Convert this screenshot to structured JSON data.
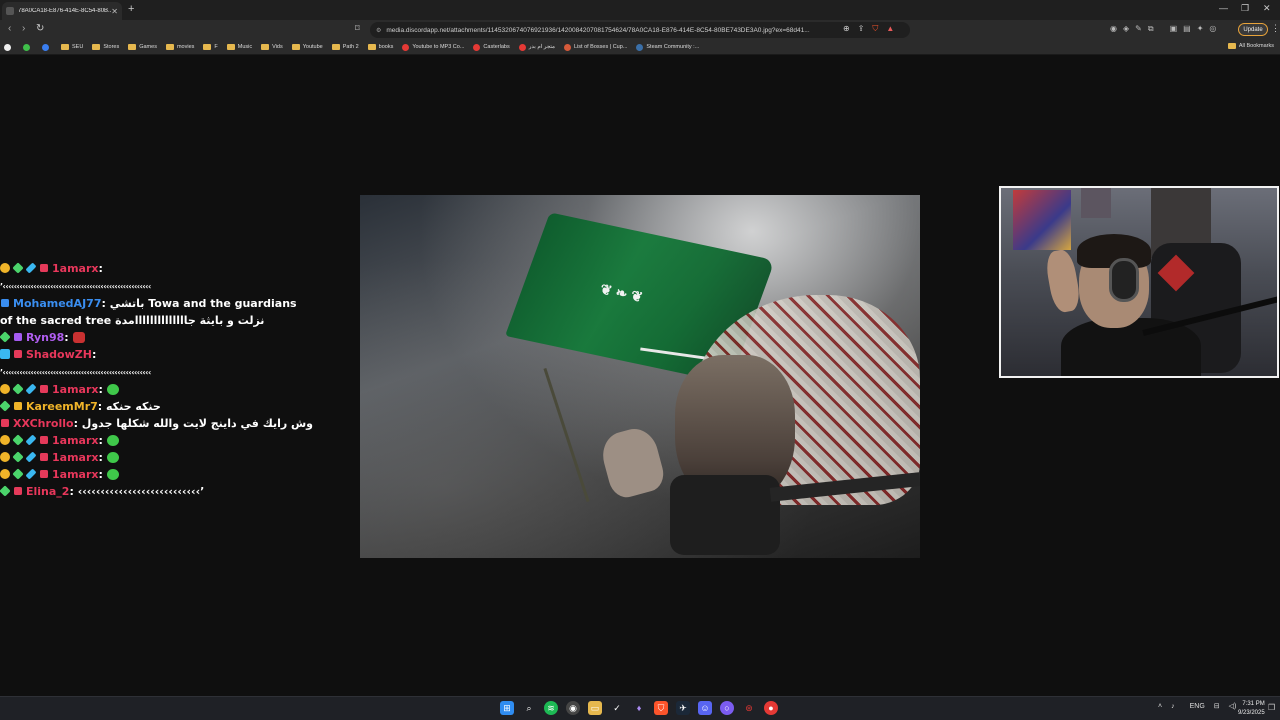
{
  "browser": {
    "tab": {
      "title": "78A0CA18-E876-414E-8C54-80B..."
    },
    "url": "media.discordapp.net/attachments/1145320674076921936/1420084207081754624/78A0CA18-E876-414E-8C54-80BE743DE3A0.jpg?ex=68d41...",
    "update_label": "Update",
    "bookmarks": [
      {
        "label": "SEU",
        "kind": "folder"
      },
      {
        "label": "Stores",
        "kind": "folder"
      },
      {
        "label": "Games",
        "kind": "folder"
      },
      {
        "label": "movies",
        "kind": "folder"
      },
      {
        "label": "F",
        "kind": "folder"
      },
      {
        "label": "Music",
        "kind": "folder"
      },
      {
        "label": "Vids",
        "kind": "folder"
      },
      {
        "label": "Youtube",
        "kind": "folder"
      },
      {
        "label": "Path 2",
        "kind": "folder"
      },
      {
        "label": "books",
        "kind": "folder"
      },
      {
        "label": "Youtube to MP3 Co...",
        "kind": "site",
        "color": "#e53935"
      },
      {
        "label": "Casterlabs",
        "kind": "site",
        "color": "#e53935"
      },
      {
        "label": "متجر ام بدر",
        "kind": "site",
        "color": "#e53935"
      },
      {
        "label": "List of Bosses | Cup...",
        "kind": "site",
        "color": "#d65a3a"
      },
      {
        "label": "Steam Community :...",
        "kind": "site",
        "color": "#3a6fa8"
      }
    ],
    "all_bookmarks_label": "All Bookmarks"
  },
  "chat": [
    {
      "badges": [
        "gold",
        "green",
        "sword",
        "red"
      ],
      "user": "1amarx",
      "user_color": "#e8375b",
      "text": ""
    },
    {
      "badges": [],
      "user": "",
      "user_color": "#ffffff",
      "text": "’‹‹‹‹‹‹‹‹‹‹‹‹‹‹‹‹‹‹‹‹‹‹‹‹‹‹‹‹‹‹‹‹‹‹‹‹‹‹‹‹‹‹‹‹‹‹‹‹‹‹‹‹‹"
    },
    {
      "badges": [
        "blue"
      ],
      "user": "MohamedAJ77",
      "user_color": "#3a8ef0",
      "text": "باتشي Towa and the guardians of the sacred tree نزلت و بايثة جاااااااااااااامدة",
      "wrap": true
    },
    {
      "badges": [
        "green",
        "purple"
      ],
      "user": "Ryn98",
      "user_color": "#b05ef0",
      "text": "",
      "emote": "red"
    },
    {
      "badges": [
        "cube",
        "red"
      ],
      "user": "ShadowZH",
      "user_color": "#e8375b",
      "text": ""
    },
    {
      "badges": [],
      "user": "",
      "user_color": "#ffffff",
      "text": "’‹‹‹‹‹‹‹‹‹‹‹‹‹‹‹‹‹‹‹‹‹‹‹‹‹‹‹‹‹‹‹‹‹‹‹‹‹‹‹‹‹‹‹‹‹‹‹‹‹‹‹‹‹"
    },
    {
      "badges": [
        "gold",
        "green",
        "sword",
        "red"
      ],
      "user": "1amarx",
      "user_color": "#e8375b",
      "text": "",
      "emote": "green"
    },
    {
      "badges": [
        "green",
        "gold-k"
      ],
      "user": "KareemMr7",
      "user_color": "#f0b429",
      "text": "حنكه حنكه"
    },
    {
      "badges": [
        "red"
      ],
      "user": "XXChrollo",
      "user_color": "#e8375b",
      "text": "وش رايك في داينج لايت والله شكلها جدول"
    },
    {
      "badges": [
        "gold",
        "green",
        "sword",
        "red"
      ],
      "user": "1amarx",
      "user_color": "#e8375b",
      "text": "",
      "emote": "green"
    },
    {
      "badges": [
        "gold",
        "green",
        "sword",
        "red"
      ],
      "user": "1amarx",
      "user_color": "#e8375b",
      "text": "",
      "emote": "green"
    },
    {
      "badges": [
        "gold",
        "green",
        "sword",
        "red"
      ],
      "user": "1amarx",
      "user_color": "#e8375b",
      "text": "",
      "emote": "green"
    },
    {
      "badges": [
        "green",
        "red"
      ],
      "user": "Elina_2",
      "user_color": "#e8375b",
      "text": "‹‹‹‹‹‹‹‹‹‹‹‹‹‹‹‹‹‹‹‹‹‹‹‹‹‹‹’"
    }
  ],
  "taskbar": {
    "language": "ENG",
    "time": "7:31 PM",
    "date": "9/23/2025"
  }
}
